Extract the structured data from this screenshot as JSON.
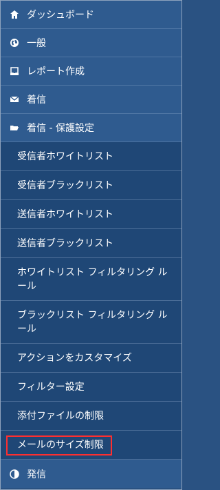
{
  "menu": {
    "top": [
      {
        "label": "ダッシュボード",
        "icon": "home-icon"
      },
      {
        "label": "一般",
        "icon": "globe-icon"
      },
      {
        "label": "レポート作成",
        "icon": "inbox-icon"
      },
      {
        "label": "着信",
        "icon": "mail-icon"
      },
      {
        "label": "着信 - 保護設定",
        "icon": "folder-open-icon"
      },
      {
        "label": "発信",
        "icon": "contrast-icon"
      }
    ],
    "sub": [
      {
        "label": "受信者ホワイトリスト"
      },
      {
        "label": "受信者ブラックリスト"
      },
      {
        "label": "送信者ホワイトリスト"
      },
      {
        "label": "送信者ブラックリスト"
      },
      {
        "label": "ホワイトリスト フィルタリング ルール"
      },
      {
        "label": "ブラックリスト フィルタリング ルール"
      },
      {
        "label": "アクションをカスタマイズ"
      },
      {
        "label": "フィルター設定"
      },
      {
        "label": "添付ファイルの制限"
      },
      {
        "label": "メールのサイズ制限"
      }
    ]
  },
  "colors": {
    "top_bg": "#2f5b8f",
    "sub_bg": "#1f4776",
    "highlight": "#ff2f2f"
  }
}
